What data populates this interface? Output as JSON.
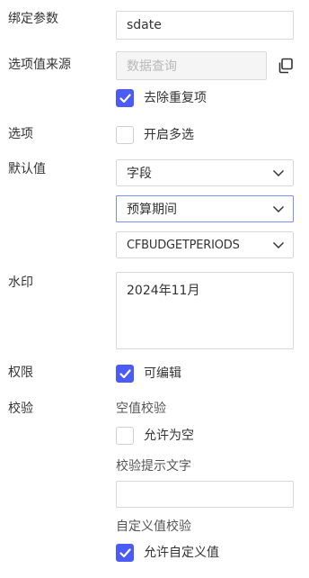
{
  "bind_param": {
    "label": "绑定参数",
    "value": "sdate"
  },
  "option_source": {
    "label": "选项值来源",
    "placeholder": "数据查询",
    "copy_icon": "copy-icon"
  },
  "dedupe": {
    "label": "去除重复项",
    "checked": true
  },
  "options": {
    "label": "选项",
    "multi_label": "开启多选",
    "checked": false
  },
  "default_value": {
    "label": "默认值",
    "type_select": "字段",
    "table_select": "预算期间",
    "field_select": "CFBUDGETPERIODS",
    "caret_icon": "chevron-down-icon"
  },
  "watermark": {
    "label": "水印",
    "value": "2024年11月"
  },
  "permission": {
    "label": "权限",
    "editable_label": "可编辑",
    "checked": true
  },
  "validation": {
    "label": "校验",
    "empty_title": "空值校验",
    "allow_empty_label": "允许为空",
    "allow_empty_checked": false,
    "hint_title": "校验提示文字",
    "hint_value": "",
    "custom_title": "自定义值校验",
    "allow_custom_label": "允许自定义值",
    "allow_custom_checked": true
  },
  "colors": {
    "accent": "#4a5bf7",
    "focus_border": "#7b8cff",
    "border": "#d9d9d9",
    "disabled_bg": "#f5f5f5"
  }
}
